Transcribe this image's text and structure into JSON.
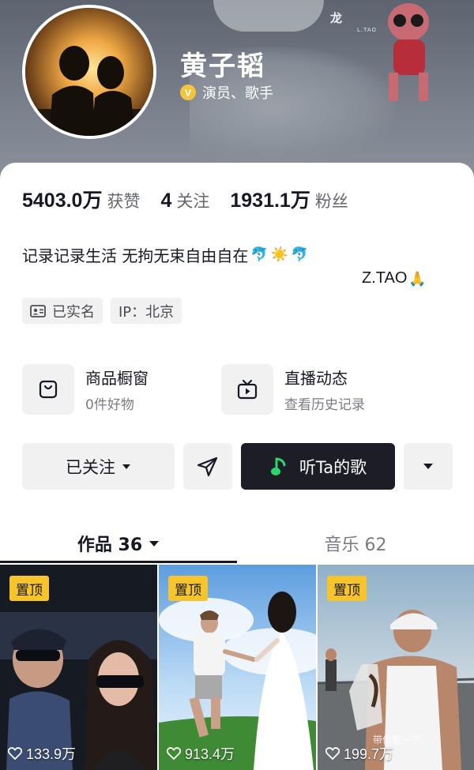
{
  "cover": {
    "brand": "龙",
    "brand_sub": "L.TAO"
  },
  "profile": {
    "name": "黄子韬",
    "verify_badge": "V",
    "verify_text": "演员、歌手"
  },
  "stats": [
    {
      "value": "5403.0万",
      "label": "获赞"
    },
    {
      "value": "4",
      "label": "关注"
    },
    {
      "value": "1931.1万",
      "label": "粉丝"
    }
  ],
  "bio": {
    "text": "记录记录生活 无拘无束自由自在",
    "emojis": [
      "🐬",
      "☀️",
      "🐬"
    ],
    "signature": "Z.TAO",
    "signature_emoji": "🙏"
  },
  "tags": [
    {
      "icon": "id-card-icon",
      "label": "已实名"
    },
    {
      "icon": "",
      "label": "IP：北京"
    }
  ],
  "shortcuts": [
    {
      "icon": "shopping-bag-icon",
      "title": "商品橱窗",
      "subtitle": "0件好物"
    },
    {
      "icon": "live-tv-icon",
      "title": "直播动态",
      "subtitle": "查看历史记录"
    }
  ],
  "actions": {
    "follow_label": "已关注",
    "song_label": "听Ta的歌"
  },
  "tabs": [
    {
      "label": "作品 36",
      "active": true
    },
    {
      "label": "音乐 62",
      "active": false
    }
  ],
  "videos": [
    {
      "pin_label": "置顶",
      "likes": "133.9万"
    },
    {
      "pin_label": "置顶",
      "likes": "913.4万"
    },
    {
      "pin_label": "置顶",
      "likes": "199.7万",
      "caption": "带你看一下"
    }
  ],
  "colors": {
    "accent_dark": "#1c1d26",
    "pin_yellow": "#f7c52b",
    "verify_gold": "#f4c43a",
    "music_green": "#2bd66b"
  }
}
